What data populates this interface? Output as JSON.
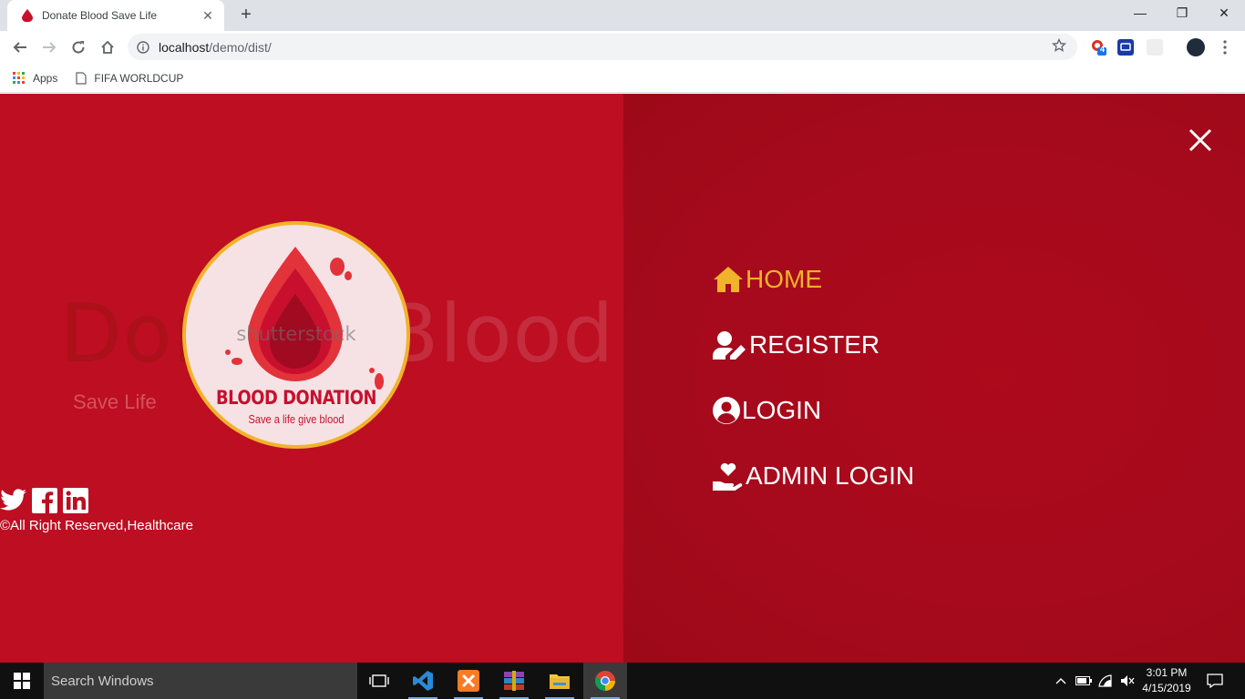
{
  "browser": {
    "tab": {
      "title": "Donate Blood Save Life",
      "close": "✕"
    },
    "new_tab": "+",
    "window_controls": {
      "minimize": "—",
      "maximize": "❐",
      "close": "✕"
    },
    "address": {
      "host": "localhost",
      "path": "/demo/dist/"
    },
    "extension_badge": "4",
    "bookmarks": [
      {
        "label": "Apps"
      },
      {
        "label": "FIFA WORLDCUP"
      }
    ]
  },
  "page": {
    "hero": {
      "title_part1": "Donate",
      "title_part2": " Blood",
      "subtitle": "Save Life"
    },
    "logo": {
      "title": "BLOOD DONATION",
      "subtitle": "Save a life give blood",
      "watermark": "shutterstock"
    },
    "footer": {
      "copyright": "©All Right Reserved,Healthcare"
    },
    "social": [
      "twitter-icon",
      "facebook-icon",
      "linkedin-icon"
    ],
    "menu": [
      {
        "label": "HOME",
        "icon": "home-icon",
        "active": true
      },
      {
        "label": "REGISTER",
        "icon": "user-edit-icon",
        "active": false
      },
      {
        "label": "LOGIN",
        "icon": "user-circle-icon",
        "active": false
      },
      {
        "label": "ADMIN LOGIN",
        "icon": "hand-heart-icon",
        "active": false
      }
    ],
    "colors": {
      "left_bg": "#bd0e22",
      "right_bg": "#a50a1c",
      "accent": "#f1b32b"
    }
  },
  "taskbar": {
    "search_placeholder": "Search Windows",
    "apps": [
      "task-view-icon",
      "vscode-icon",
      "xampp-icon",
      "winrar-icon",
      "file-explorer-icon",
      "chrome-icon"
    ],
    "clock": {
      "time": "3:01 PM",
      "date": "4/15/2019"
    }
  }
}
